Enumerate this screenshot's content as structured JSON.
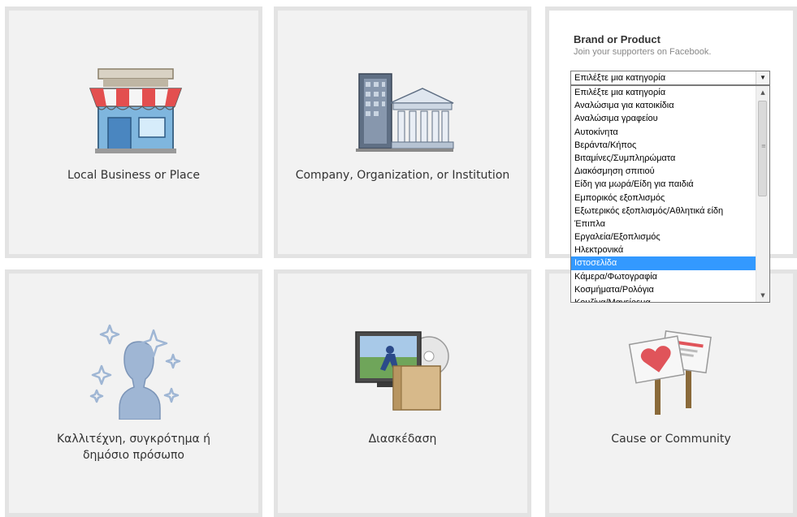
{
  "tiles": {
    "local_business": {
      "label": "Local Business or Place",
      "icon": "storefront-icon"
    },
    "company": {
      "label": "Company, Organization, or Institution",
      "icon": "buildings-icon"
    },
    "brand": {
      "title": "Brand or Product",
      "subtitle": "Join your supporters on Facebook.",
      "icon": "none"
    },
    "artist": {
      "label": "Καλλιτέχνη, συγκρότημα ή δημόσιο πρόσωπο",
      "icon": "person-sparkle-icon"
    },
    "entertainment": {
      "label": "Διασκέδαση",
      "icon": "tv-disc-book-icon"
    },
    "cause": {
      "label": "Cause or Community",
      "icon": "heart-signs-icon"
    }
  },
  "category_select": {
    "selected_value": "Επιλέξτε μια κατηγορία",
    "highlighted_index": 13,
    "options": [
      "Επιλέξτε μια κατηγορία",
      "Αναλώσιμα για κατοικίδια",
      "Αναλώσιμα γραφείου",
      "Αυτοκίνητα",
      "Βεράντα/Κήπος",
      "Βιταμίνες/Συμπληρώματα",
      "Διακόσμηση σπιτιού",
      "Είδη για μωρά/Είδη για παιδιά",
      "Εμπορικός εξοπλισμός",
      "Εξωτερικός εξοπλισμός/Αθλητικά είδη",
      "Έπιπλα",
      "Εργαλεία/Εξοπλισμός",
      "Ηλεκτρονικά",
      "Ιστοσελίδα",
      "Κάμερα/Φωτογραφία",
      "Κοσμήματα/Ρολόγια",
      "Κουζίνα/Μαγείρεμα"
    ]
  },
  "colors": {
    "tile_bg": "#f2f2f2",
    "tile_border": "#e3e3e3",
    "highlight": "#3399ff",
    "awning_red": "#e34f4f",
    "shop_blue": "#5b9bd5"
  }
}
